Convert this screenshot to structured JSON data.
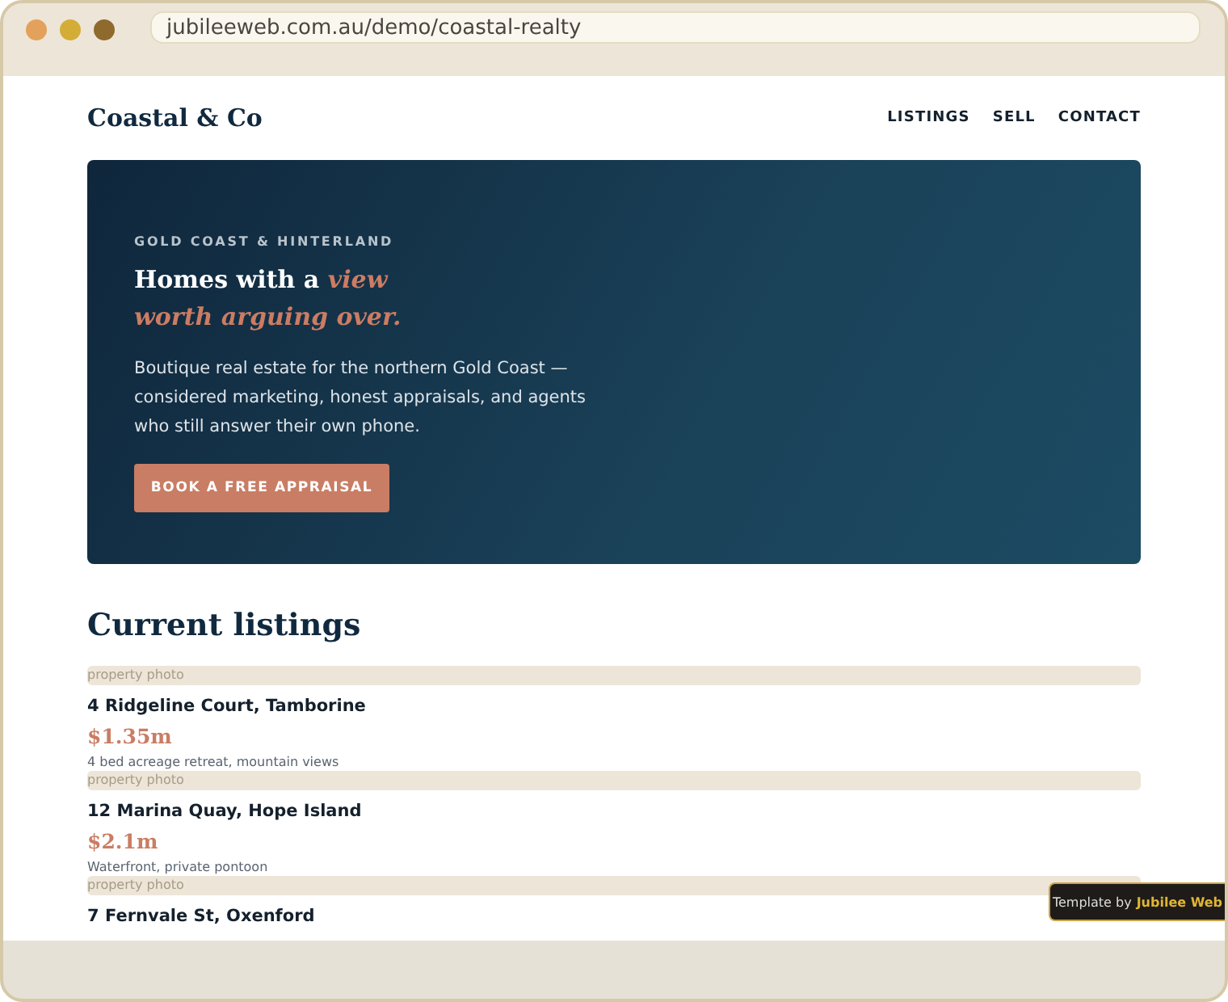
{
  "browser": {
    "url": "jubileeweb.com.au/demo/coastal-realty"
  },
  "site": {
    "logo": "Coastal & Co",
    "nav": [
      {
        "label": "LISTINGS"
      },
      {
        "label": "SELL"
      },
      {
        "label": "CONTACT"
      }
    ]
  },
  "hero": {
    "eyebrow": "GOLD COAST & HINTERLAND",
    "headline": "Homes with a *view worth arguing over.*",
    "body": "Boutique real estate for the northern Gold Coast — considered marketing, honest appraisals, and agents who still answer their own phone.",
    "button": "BOOK A FREE APPRAISAL"
  },
  "listings": {
    "title": "Current listings",
    "items": [
      {
        "photo": "property photo",
        "address": "4 Ridgeline Court, Tamborine",
        "price": "$1.35m",
        "description": "4 bed acreage retreat, mountain views"
      },
      {
        "photo": "property photo",
        "address": "12 Marina Quay, Hope Island",
        "price": "$2.1m",
        "description": "Waterfront, private pontoon"
      },
      {
        "photo": "property photo",
        "address": "7 Fernvale St, Oxenford"
      }
    ]
  },
  "badge": {
    "prefix": "Template by",
    "brand": "Jubilee Web"
  }
}
